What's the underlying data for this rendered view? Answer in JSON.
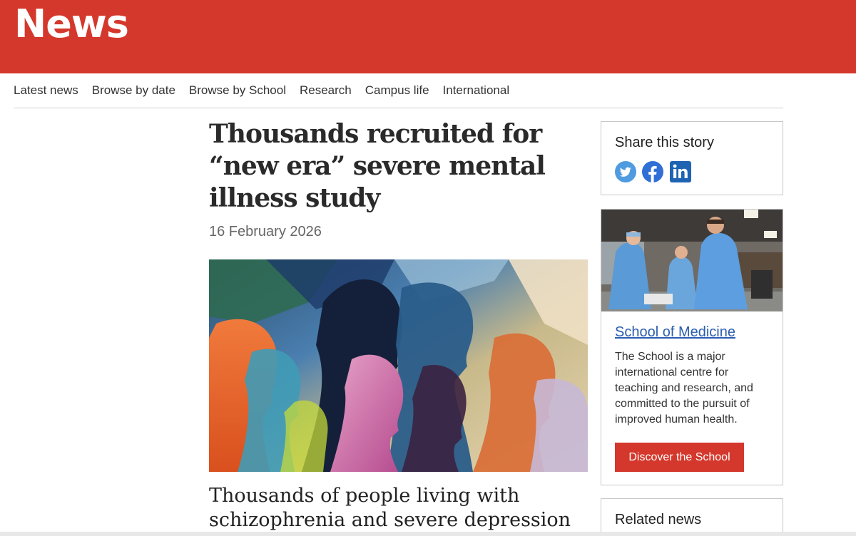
{
  "site": {
    "title": "News",
    "brand_color": "#d4382c"
  },
  "nav": {
    "items": [
      {
        "label": "Latest news"
      },
      {
        "label": "Browse by date"
      },
      {
        "label": "Browse by School"
      },
      {
        "label": "Research"
      },
      {
        "label": "Campus life"
      },
      {
        "label": "International"
      }
    ]
  },
  "article": {
    "headline": "Thousands recruited for “new era” severe mental illness study",
    "date": "16 February 2026",
    "lead": "Thousands of people living with schizophrenia and severe depression are"
  },
  "share": {
    "title": "Share this story",
    "icons": [
      "twitter-icon",
      "facebook-icon",
      "linkedin-icon"
    ]
  },
  "school": {
    "link": "School of Medicine",
    "description": "The School is a major international centre for teaching and research, and committed to the pursuit of improved human health.",
    "button": "Discover the School"
  },
  "related": {
    "title": "Related news"
  }
}
